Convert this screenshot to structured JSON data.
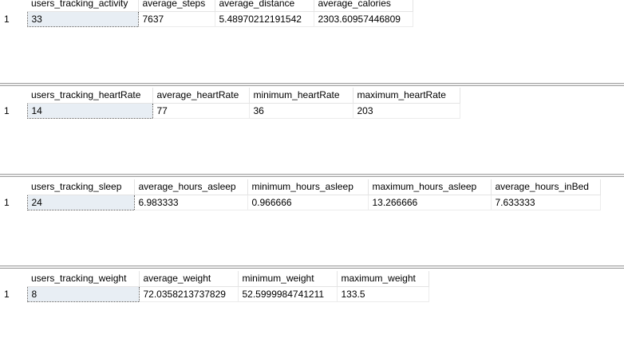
{
  "results": [
    {
      "columns": [
        "users_tracking_activity",
        "average_steps",
        "average_distance",
        "average_calories"
      ],
      "rows": [
        {
          "row_number": "1",
          "cells": [
            "33",
            "7637",
            "5.48970212191542",
            "2303.60957446809"
          ]
        }
      ]
    },
    {
      "columns": [
        "users_tracking_heartRate",
        "average_heartRate",
        "minimum_heartRate",
        "maximum_heartRate"
      ],
      "rows": [
        {
          "row_number": "1",
          "cells": [
            "14",
            "77",
            "36",
            "203"
          ]
        }
      ]
    },
    {
      "columns": [
        "users_tracking_sleep",
        "average_hours_asleep",
        "minimum_hours_asleep",
        "maximum_hours_asleep",
        "average_hours_inBed"
      ],
      "rows": [
        {
          "row_number": "1",
          "cells": [
            "24",
            "6.983333",
            "0.966666",
            "13.266666",
            "7.633333"
          ]
        }
      ]
    },
    {
      "columns": [
        "users_tracking_weight",
        "average_weight",
        "minimum_weight",
        "maximum_weight"
      ],
      "rows": [
        {
          "row_number": "1",
          "cells": [
            "8",
            "72.0358213737829",
            "52.5999984741211",
            "133.5"
          ]
        }
      ]
    }
  ]
}
